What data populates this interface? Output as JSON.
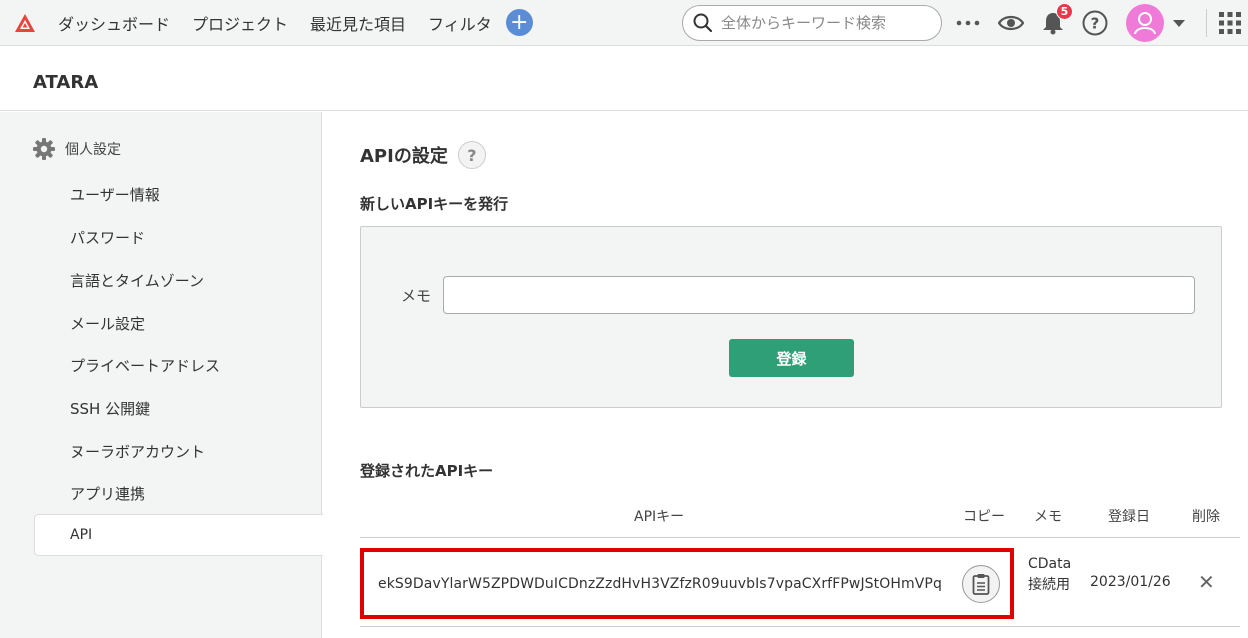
{
  "topbar": {
    "nav": [
      "ダッシュボード",
      "プロジェクト",
      "最近見た項目",
      "フィルタ"
    ],
    "add_icon": "plus-icon",
    "search_placeholder": "全体からキーワード検索",
    "notification_count": "5",
    "icons": [
      "more-icon",
      "eye-icon",
      "bell-icon",
      "help-icon",
      "user-icon",
      "caret-down-icon",
      "apps-grid-icon"
    ],
    "brand_color": "#e8463a"
  },
  "project": {
    "name": "ATARA"
  },
  "sidebar": {
    "heading": "個人設定",
    "items": [
      {
        "label": "ユーザー情報"
      },
      {
        "label": "パスワード"
      },
      {
        "label": "言語とタイムゾーン"
      },
      {
        "label": "メール設定"
      },
      {
        "label": "プライベートアドレス"
      },
      {
        "label": "SSH 公開鍵"
      },
      {
        "label": "ヌーラボアカウント"
      },
      {
        "label": "アプリ連携"
      },
      {
        "label": "API",
        "active": true
      }
    ]
  },
  "main": {
    "title": "APIの設定",
    "help_label": "?",
    "new_key_section": "新しいAPIキーを発行",
    "memo_label": "メモ",
    "memo_value": "",
    "register_button": "登録",
    "registered_section": "登録されたAPIキー",
    "table": {
      "headers": {
        "key": "APIキー",
        "copy": "コピー",
        "memo": "メモ",
        "date": "登録日",
        "delete": "削除"
      },
      "rows": [
        {
          "key": "ekS9DavYlarW5ZPDWDuICDnzZzdHvH3VZfzR09uuvbIs7vpaCXrfFPwJStOHmVPq",
          "memo": "CData接続用",
          "date": "2023/01/26",
          "delete": "✕"
        }
      ]
    },
    "accent_color": "#2e9f77",
    "highlight_color": "#e00000"
  }
}
